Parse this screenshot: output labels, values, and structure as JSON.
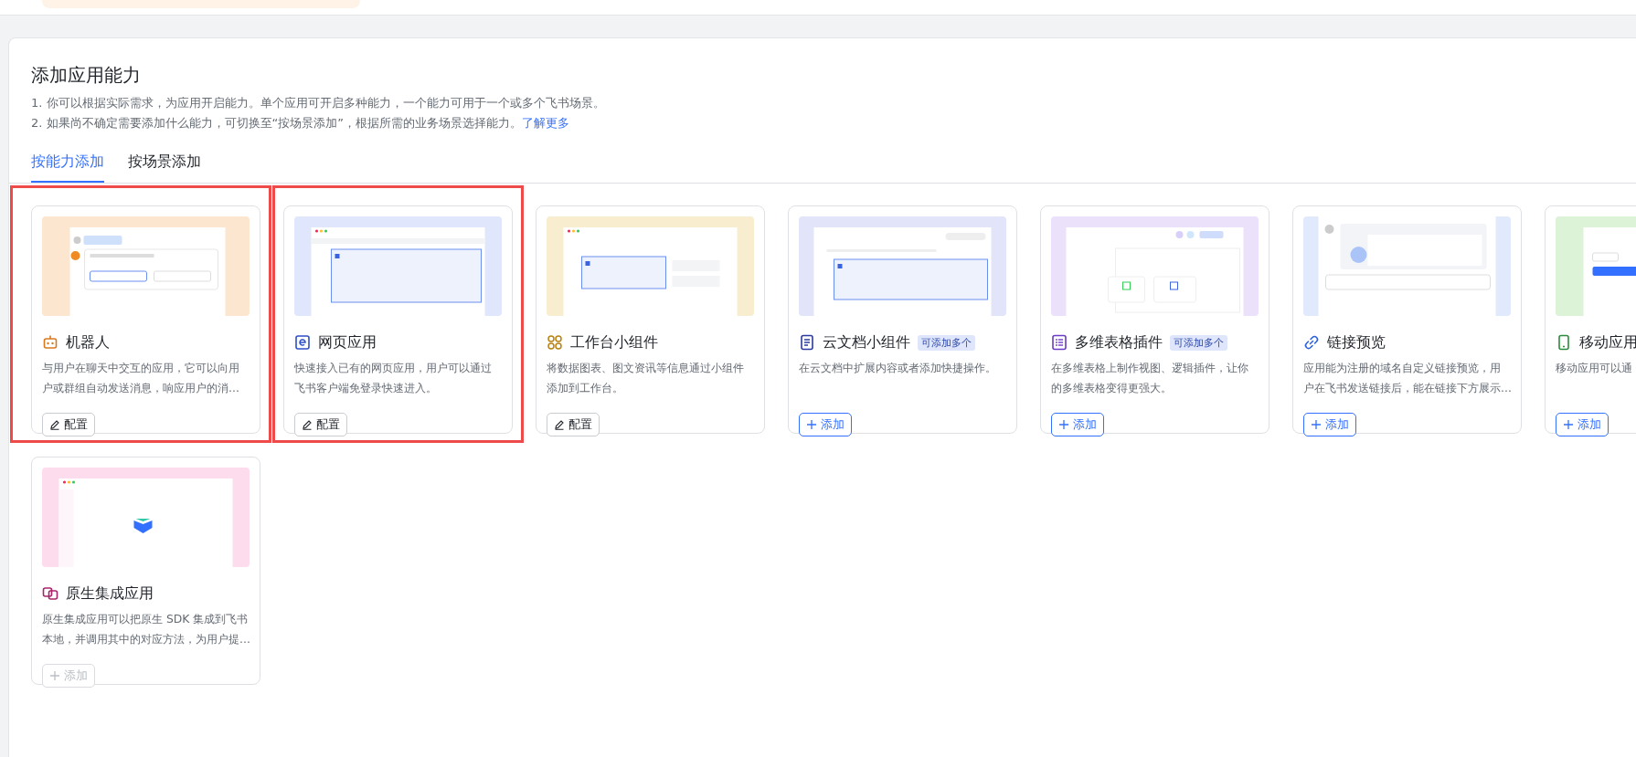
{
  "title": "添加应用能力",
  "notes": [
    "1. 你可以根据实际需求，为应用开启能力。单个应用可开启多种能力，一个能力可用于一个或多个飞书场景。",
    "2. 如果尚不确定需要添加什么能力，可切换至“按场景添加”，根据所需的业务场景选择能力。"
  ],
  "learn_more": "了解更多",
  "tabs": [
    {
      "label": "按能力添加",
      "selected": true
    },
    {
      "label": "按场景添加",
      "selected": false
    }
  ],
  "cards": [
    {
      "kind": "robot",
      "color": "#fde6cf",
      "title": "机器人",
      "description": [
        "与用户在聊天中交互的应用，它可以向用",
        "户或群组自动发送消息，响应用户的消..."
      ],
      "button": {
        "kind": "configure",
        "label": "配置",
        "disabled": false
      },
      "highlighted": true
    },
    {
      "kind": "web",
      "color": "#e0e7fc",
      "title": "网页应用",
      "description": [
        "快速接入已有的网页应用，用户可以通过",
        "飞书客户端免登录快速进入。"
      ],
      "button": {
        "kind": "configure",
        "label": "配置",
        "disabled": false
      },
      "highlighted": true
    },
    {
      "kind": "widget",
      "color": "#f8eecf",
      "title": "工作台小组件",
      "description": [
        "将数据图表、图文资讯等信息通过小组件",
        "添加到工作台。"
      ],
      "button": {
        "kind": "configure",
        "label": "配置",
        "disabled": false
      },
      "highlighted": false
    },
    {
      "kind": "doc",
      "color": "#e2e4f9",
      "title": "云文档小组件",
      "badge": "可添加多个",
      "description": [
        "在云文档中扩展内容或者添加快捷操作。"
      ],
      "button": {
        "kind": "add",
        "label": "添加",
        "disabled": false
      },
      "highlighted": false
    },
    {
      "kind": "table",
      "color": "#ece1fb",
      "title": "多维表格插件",
      "badge": "可添加多个",
      "description": [
        "在多维表格上制作视图、逻辑插件，让你",
        "的多维表格变得更强大。"
      ],
      "button": {
        "kind": "add",
        "label": "添加",
        "disabled": false
      },
      "highlighted": false
    },
    {
      "kind": "link",
      "color": "#e1e9fd",
      "title": "链接预览",
      "description": [
        "应用能为注册的域名自定义链接预览，用",
        "户在飞书发送链接后，能在链接下方展示..."
      ],
      "button": {
        "kind": "add",
        "label": "添加",
        "disabled": false
      },
      "highlighted": false
    },
    {
      "kind": "phone",
      "color": "#dcf3d8",
      "title": "移动应用",
      "description": [
        "移动应用可以通"
      ],
      "button": {
        "kind": "add",
        "label": "添加",
        "disabled": false
      },
      "highlighted": false
    },
    {
      "kind": "native",
      "color": "#fcdced",
      "title": "原生集成应用",
      "description": [
        "原生集成应用可以把原生 SDK 集成到飞书",
        "本地，并调用其中的对应方法，为用户提..."
      ],
      "button": {
        "kind": "add",
        "label": "添加",
        "disabled": true
      },
      "highlighted": false
    }
  ]
}
